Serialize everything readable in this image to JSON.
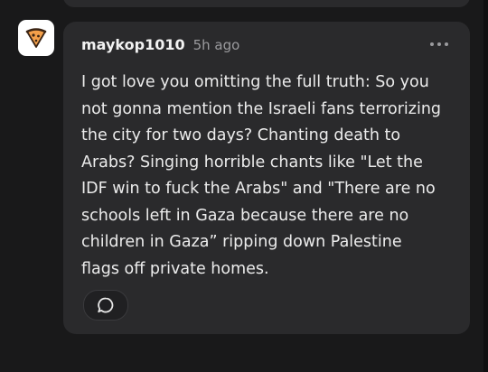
{
  "comment": {
    "author": "maykop1010",
    "time": "5h ago",
    "avatar_icon": "pizza-slice-icon",
    "body": "I got love you omitting the full truth: So you\nnot gonna mention the Israeli fans terrorizing\nthe city for two days? Chanting death to\nArabs? Singing horrible chants like \"Let the\nIDF win to fuck the Arabs\" and \"There are no\nschools left in Gaza because there are no\nchildren in Gaza” ripping down Palestine\nflags off private homes.",
    "more_icon": "more-horizontal-icon",
    "reply_icon": "speech-bubble-icon"
  },
  "colors": {
    "background": "#19191a",
    "card": "#2a2a2c",
    "text": "#ececec",
    "muted": "#9b9b9e"
  }
}
